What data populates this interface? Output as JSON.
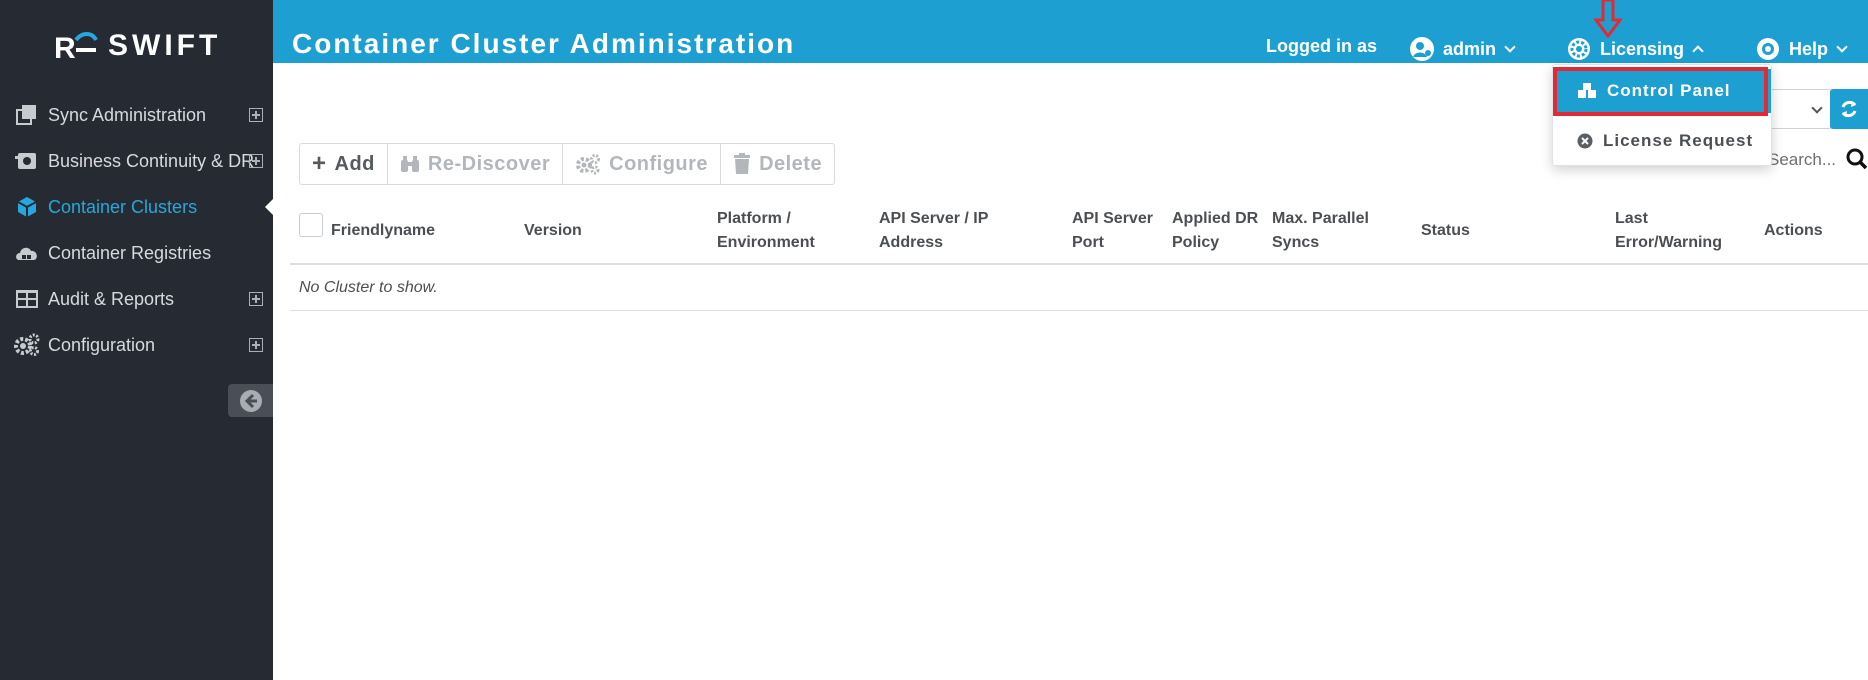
{
  "app": {
    "brand": "SWIFT"
  },
  "sidebar": {
    "items": [
      {
        "label": "Sync Administration",
        "expandable": true,
        "active": false
      },
      {
        "label": "Business Continuity & DR",
        "expandable": true,
        "active": false
      },
      {
        "label": "Container Clusters",
        "expandable": false,
        "active": true
      },
      {
        "label": "Container Registries",
        "expandable": false,
        "active": false
      },
      {
        "label": "Audit & Reports",
        "expandable": true,
        "active": false
      },
      {
        "label": "Configuration",
        "expandable": true,
        "active": false
      }
    ]
  },
  "header": {
    "title": "Container Cluster Administration",
    "logged_in_label": "Logged in as",
    "user": "admin",
    "licensing": "Licensing",
    "help": "Help"
  },
  "licensing_menu": {
    "items": [
      {
        "label": "Control Panel",
        "highlighted": true
      },
      {
        "label": "License Request",
        "highlighted": false
      }
    ]
  },
  "toolbar": {
    "add": "Add",
    "rediscover": "Re-Discover",
    "configure": "Configure",
    "delete": "Delete"
  },
  "search": {
    "placeholder": "Search..."
  },
  "table": {
    "columns": [
      "Friendlyname",
      "Version",
      "Platform / Environment",
      "API Server / IP Address",
      "API Server Port",
      "Applied DR Policy",
      "Max. Parallel Syncs",
      "Status",
      "Last Error/Warning",
      "Actions"
    ],
    "empty_message": "No Cluster to show."
  },
  "colors": {
    "header_bg": "#1e9fd2",
    "sidebar_bg": "#262b33",
    "active_nav": "#27a7dd",
    "annotation": "#e02b35"
  }
}
